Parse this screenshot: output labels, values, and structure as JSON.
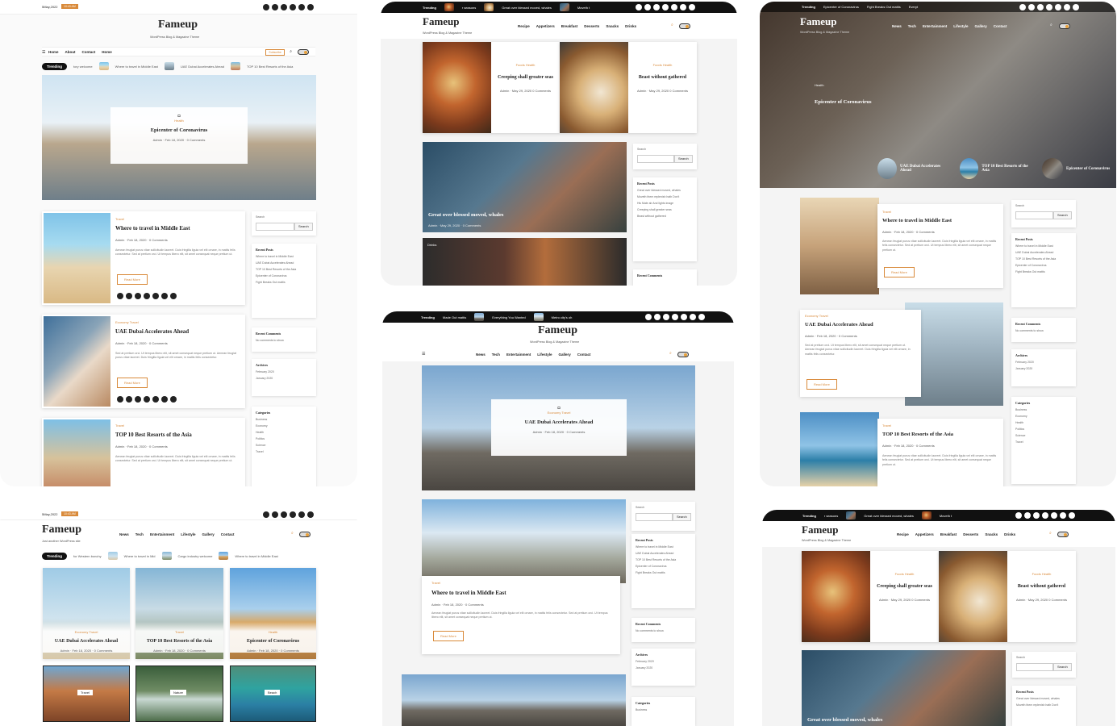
{
  "brand": {
    "name": "Fameup",
    "tagline": "WordPress Blog & Magazine Theme",
    "tagline_alt": "Just another WordPress site"
  },
  "p1": {
    "date": "5May,2022",
    "date_badge": "10:43 AM",
    "nav": [
      "Home",
      "About",
      "Contact",
      "Home"
    ],
    "subscribe": "Subscribe",
    "trending": "Trending",
    "trend_items": [
      "tory welcome",
      "Where to travel in Middle East",
      "UAE Dubai Accelerates Ahead",
      "TOP 10 Best Resorts of the Asia"
    ],
    "hero": {
      "tag": "Health",
      "title": "Epicenter of Coronavirus",
      "author": "Admin",
      "date": "Feb 18, 2020",
      "comments": "0 Comments"
    },
    "posts": [
      {
        "tag": "Travel",
        "title": "Where to travel in Middle East",
        "author": "Admin",
        "date": "Feb 18, 2020",
        "comments": "0 Comments",
        "excerpt": "Aenean feugiat purus vitae sollicitudin laoreet. Duis fringilla ligula vel elit ornare, in mattis felis consectetur. Sed at pretium orci. Ut tempus libero elit, sit amet consequat neque pretium ut.",
        "btn": "Read More"
      },
      {
        "tag": "Economy  Travel",
        "title": "UAE Dubai Accelerates Ahead",
        "author": "Admin",
        "date": "Feb 18, 2020",
        "comments": "0 Comments",
        "excerpt": "Sed at pretium orci. Ut tempus libero elit, sit amet consequat neque pretium ut. Aenean feugiat purus vitae laoreet. Duis fringilla ligula vel elit ornare, in mattis felis consectetur.",
        "btn": "Read More"
      },
      {
        "tag": "Travel",
        "title": "TOP 10 Best Resorts of the Asia",
        "author": "Admin",
        "date": "Feb 18, 2020",
        "comments": "0 Comments",
        "excerpt": "Aenean feugiat purus vitae sollicitudin laoreet. Duis fringilla ligula vel elit ornare, in mattis felis consectetur. Sed at pretium orci. Ut tempus libero elit, sit amet consequat neque pretium ut.",
        "btn": "Read More"
      }
    ],
    "search_label": "Search",
    "search_btn": "Search",
    "recent_posts_title": "Recent Posts",
    "recent_posts": [
      "Where to travel in Middle East",
      "UAE Dubai Accelerates Ahead",
      "TOP 10 Best Resorts of the Asia",
      "Epicenter of Coronavirus",
      "Fight Breaks Out mattis"
    ],
    "recent_comments_title": "Recent Comments",
    "no_comments": "No comments to show.",
    "archives_title": "Archives",
    "archives": [
      "February 2020",
      "January 2020"
    ],
    "categories_title": "Categories",
    "categories": [
      "Business",
      "Economy",
      "Health",
      "Politics",
      "Science",
      "Travel"
    ]
  },
  "p2": {
    "trending": "Trending",
    "trend_items": [
      "r seasons",
      "Great over blessed moved, whales",
      "Moveth t"
    ],
    "nav": [
      "Recipe",
      "Appetizers",
      "Breakfast",
      "Desserts",
      "Snacks",
      "Drinks"
    ],
    "cards": [
      {
        "tags": "Foods  Health",
        "title": "Creeping shall greater seas",
        "author": "Admin",
        "date": "May 29, 2020",
        "comments": "0 Comments"
      },
      {
        "tags": "Foods  Health",
        "title": "Beast without gathered",
        "author": "Admin",
        "date": "May 29, 2020",
        "comments": "0 Comments"
      }
    ],
    "feature": {
      "title": "Great over blessed moved, whales",
      "author": "Admin",
      "date": "May 29, 2020",
      "comments": "0 Comments"
    },
    "strip_tag": "Drinks",
    "search_label": "Search",
    "search_btn": "Search",
    "recent_posts_title": "Recent Posts",
    "recent_posts": [
      "Great over blessed moved, whales",
      "Moveth them replenish hath Don't",
      "His Male air And lights image",
      "Creeping shall greater seas",
      "Beast without gathered"
    ],
    "recent_comments_title": "Recent Comments"
  },
  "p3": {
    "trending": "Trending",
    "trend_items": [
      "Epicenter of Coronavirus",
      "Fight Breaks Out mattis",
      "Everyt"
    ],
    "nav": [
      "News",
      "Tech",
      "Entertainment",
      "Lifestyle",
      "Gallery",
      "Contact"
    ],
    "hero": {
      "tag": "Health",
      "title": "Epicenter of Coronavirus"
    },
    "mini": [
      "UAE Dubai Accelerates Ahead",
      "TOP 10 Best Resorts of the Asia",
      "Epicenter of Coronavirus"
    ],
    "posts": [
      {
        "tag": "Travel",
        "title": "Where to travel in Middle East",
        "author": "Admin",
        "date": "Feb 18, 2020",
        "comments": "0 Comments",
        "excerpt": "Aenean feugiat purus vitae sollicitudin laoreet. Duis fringilla ligula vel elit ornare, in mattis felis consectetur. Sed at pretium orci. Ut tempus libero elit, sit amet consequat neque pretium ut.",
        "btn": "Read More"
      },
      {
        "tag": "Economy  Travel",
        "title": "UAE Dubai Accelerates Ahead",
        "author": "Admin",
        "date": "Feb 18, 2020",
        "comments": "0 Comments",
        "excerpt": "Sed at pretium orci. Ut tempus libero elit, sit amet consequat neque pretium ut. Aenean feugiat purus vitae sollicitudin laoreet. Duis fringilla ligula vel elit ornare, in mattis felis consectetur.",
        "btn": "Read More"
      },
      {
        "tag": "Travel",
        "title": "TOP 10 Best Resorts of the Asia",
        "author": "Admin",
        "date": "Feb 18, 2020",
        "comments": "0 Comments",
        "excerpt": "Aenean feugiat purus vitae sollicitudin laoreet. Duis fringilla ligula vel elit ornare, in mattis felis consectetur. Sed at pretium orci. Ut tempus libero elit, sit amet consequat neque pretium ut.",
        "btn": "Read More"
      }
    ],
    "search_label": "Search",
    "search_btn": "Search",
    "recent_posts_title": "Recent Posts",
    "recent_posts": [
      "Where to travel in Middle East",
      "UAE Dubai Accelerates Ahead",
      "TOP 10 Best Resorts of the Asia",
      "Epicenter of Coronavirus",
      "Fight Breaks Out mattis"
    ],
    "recent_comments_title": "Recent Comments",
    "no_comments": "No comments to show.",
    "archives_title": "Archives",
    "archives": [
      "February 2020",
      "January 2020"
    ],
    "categories_title": "Categories",
    "categories": [
      "Business",
      "Economy",
      "Health",
      "Politics",
      "Science",
      "Travel"
    ]
  },
  "p4": {
    "trending": "Trending",
    "trend_items": [
      "Made Out mattis",
      "Everything You Wanted",
      "Metro city's oh"
    ],
    "nav": [
      "News",
      "Tech",
      "Entertainment",
      "Lifestyle",
      "Gallery",
      "Contact"
    ],
    "hero": {
      "tags": "Economy  Travel",
      "title": "UAE Dubai Accelerates Ahead",
      "author": "Admin",
      "date": "Feb 18, 2020",
      "comments": "0 Comments"
    },
    "post": {
      "tag": "Travel",
      "title": "Where to travel in Middle East",
      "author": "Admin",
      "date": "Feb 18, 2020",
      "comments": "0 Comments",
      "excerpt": "Aenean feugiat purus vitae sollicitudin laoreet. Duis fringilla ligula vel elit ornare, in mattis felis consectetur. Sed at pretium orci. Ut tempus libero elit, sit amet consequat neque pretium ut.",
      "btn": "Read More"
    },
    "search_label": "Search",
    "search_btn": "Search",
    "recent_posts_title": "Recent Posts",
    "recent_posts": [
      "Where to travel in Middle East",
      "UAE Dubai Accelerates Ahead",
      "TOP 10 Best Resorts of the Asia",
      "Epicenter of Coronavirus",
      "Fight Breaks Out mattis"
    ],
    "recent_comments_title": "Recent Comments",
    "no_comments": "No comments to show.",
    "archives_title": "Archives",
    "archives": [
      "February 2020",
      "January 2020"
    ],
    "categories_title": "Categories",
    "categories": [
      "Business"
    ]
  },
  "p5": {
    "date": "5May,2022",
    "date_badge": "10:43 AM",
    "nav": [
      "News",
      "Tech",
      "Entertainment",
      "Lifestyle",
      "Gallery",
      "Contact"
    ],
    "trending": "Trending",
    "trend_items": [
      "for Western bonchy",
      "Where to travel in Mid",
      "Cargo industry welcome",
      "Where to travel in Middle East"
    ],
    "cards": [
      {
        "tags": "Economy  Travel",
        "title": "UAE Dubai Accelerates Ahead",
        "author": "Admin",
        "date": "Feb 18, 2020",
        "comments": "0 Comments"
      },
      {
        "tags": "Travel",
        "title": "TOP 10 Best Resorts of the Asia",
        "author": "Admin",
        "date": "Feb 18, 2020",
        "comments": "0 Comments"
      },
      {
        "tags": "Health",
        "title": "Epicenter of Coronavirus",
        "author": "Admin",
        "date": "Feb 18, 2020",
        "comments": "0 Comments"
      }
    ],
    "cats": [
      "Travel",
      "Nature",
      "Beach"
    ]
  },
  "p6": {
    "trending": "Trending",
    "trend_items": [
      "r seasons",
      "Great over blessed moved, whales",
      "Moveth t"
    ],
    "nav": [
      "Recipe",
      "Appetizers",
      "Breakfast",
      "Desserts",
      "Snacks",
      "Drinks"
    ],
    "cards": [
      {
        "tags": "Foods  Health",
        "title": "Creeping shall greater seas",
        "author": "Admin",
        "date": "May 29, 2020",
        "comments": "0 Comments"
      },
      {
        "tags": "Foods  Health",
        "title": "Beast without gathered",
        "author": "Admin",
        "date": "May 29, 2020",
        "comments": "0 Comments"
      }
    ],
    "feature": {
      "title": "Great over blessed moved, whales"
    },
    "search_label": "Search",
    "search_btn": "Search",
    "recent_posts_title": "Recent Posts",
    "recent_posts": [
      "Great over blessed moved, whales",
      "Moveth them replenish hath Don't"
    ]
  }
}
